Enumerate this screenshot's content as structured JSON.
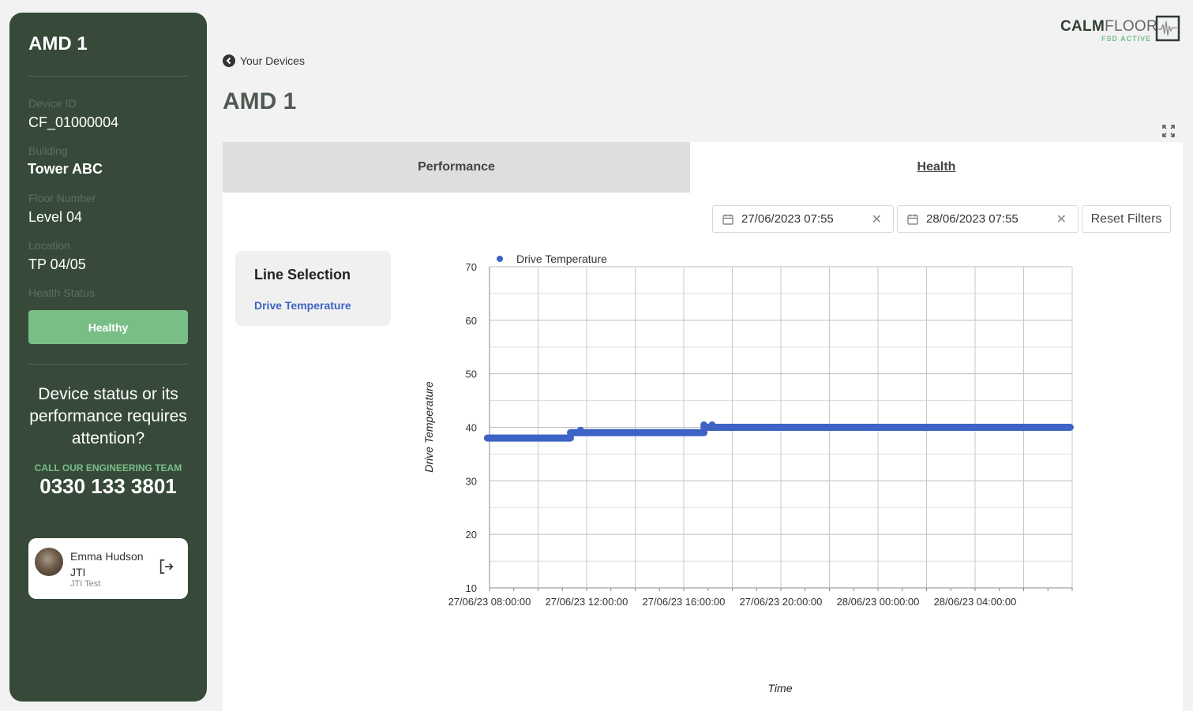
{
  "sidebar": {
    "title": "AMD 1",
    "fields": [
      {
        "label": "Device ID",
        "value": "CF_01000004"
      },
      {
        "label": "Building",
        "value": "Tower ABC"
      },
      {
        "label": "Floor Number",
        "value": "Level 04"
      },
      {
        "label": "Location",
        "value": "TP 04/05"
      }
    ],
    "health_label": "Health Status",
    "health_value": "Healthy",
    "attention_text": "Device status or its performance requires attention?",
    "call_label": "CALL OUR ENGINEERING TEAM",
    "phone": "0330 133 3801",
    "user": {
      "name": "Emma Hudson JTI",
      "org": "JTI Test"
    }
  },
  "header": {
    "logo_main": "CALM",
    "logo_light": "FLOOR",
    "logo_sub": "FSD ACTIVE",
    "back_label": "Your Devices",
    "page_title": "AMD 1"
  },
  "tabs": [
    {
      "label": "Performance",
      "active": false
    },
    {
      "label": "Health",
      "active": true
    }
  ],
  "filters": {
    "start_date": "27/06/2023 07:55",
    "end_date": "28/06/2023 07:55",
    "reset_label": "Reset Filters"
  },
  "line_selection": {
    "title": "Line Selection",
    "items": [
      "Drive Temperature"
    ]
  },
  "colors": {
    "series": "#3d63c4",
    "sidebar": "#374a3a",
    "healthy": "#79be87"
  },
  "chart_data": {
    "type": "line",
    "xlabel": "Time",
    "ylabel": "Drive Temperature",
    "ylim": [
      10,
      70
    ],
    "yticks": [
      10,
      20,
      30,
      40,
      50,
      60,
      70
    ],
    "xticks": [
      "27/06/23 08:00:00",
      "27/06/23 12:00:00",
      "27/06/23 16:00:00",
      "27/06/23 20:00:00",
      "28/06/23 00:00:00",
      "28/06/23 04:00:00"
    ],
    "legend": "top-left",
    "grid": true,
    "series": [
      {
        "name": "Drive Temperature",
        "color": "#3d63c4",
        "segments": [
          {
            "x": [
              "27/06/23 07:55",
              "27/06/23 11:20"
            ],
            "y": 38
          },
          {
            "x": [
              "27/06/23 11:20",
              "27/06/23 16:50"
            ],
            "y": 39
          },
          {
            "x": [
              "27/06/23 16:50",
              "28/06/23 07:55"
            ],
            "y": 40
          }
        ],
        "points": [
          {
            "x": "27/06/23 11:45",
            "y": 39
          },
          {
            "x": "27/06/23 16:50",
            "y": 40
          },
          {
            "x": "27/06/23 17:10",
            "y": 40
          }
        ]
      }
    ]
  }
}
